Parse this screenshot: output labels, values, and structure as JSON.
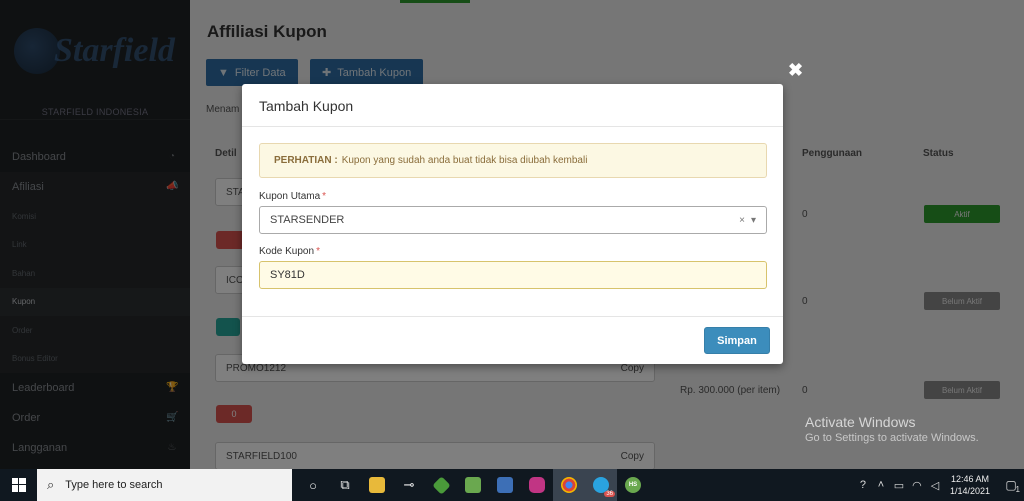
{
  "sidebar": {
    "brand_name": "Starfield",
    "org_name": "STARFIELD INDONESIA",
    "items": [
      {
        "label": "Dashboard",
        "icon": "dashboard-icon",
        "glyph": "◔"
      },
      {
        "label": "Afiliasi",
        "icon": "bullhorn-icon",
        "glyph": "📣"
      },
      {
        "label": "Komisi"
      },
      {
        "label": "Link"
      },
      {
        "label": "Bahan"
      },
      {
        "label": "Kupon"
      },
      {
        "label": "Order"
      },
      {
        "label": "Bonus Editor"
      },
      {
        "label": "Leaderboard",
        "icon": "trophy-icon",
        "glyph": "🏆"
      },
      {
        "label": "Order",
        "icon": "cart-icon",
        "glyph": "🛒"
      },
      {
        "label": "Langganan",
        "icon": "fire-icon",
        "glyph": "♨"
      }
    ]
  },
  "page": {
    "title": "Affiliasi Kupon",
    "filter_button": "Filter Data",
    "add_button": "Tambah Kupon",
    "showing_text": "Menam",
    "col_detail": "Detil",
    "col_usage": "Penggunaan",
    "col_status": "Status",
    "row1_code": "STA",
    "row2_code": "ICO",
    "row3_code": "PROMO1212",
    "row4_code": "STARFIELD100",
    "copy_label": "Copy",
    "price_text": "Rp. 300.000 (per item)",
    "usage_1": "0",
    "usage_2": "0",
    "usage_3": "0",
    "status_1": "Aktif",
    "status_2": "Belum Aktif",
    "status_3": "Belum Aktif",
    "badge_count": "0"
  },
  "modal": {
    "title": "Tambah Kupon",
    "alert_strong": "PERHATIAN :",
    "alert_text": "Kupon yang sudah anda buat tidak bisa diubah kembali",
    "kupon_utama_label": "Kupon Utama",
    "required_mark": "*",
    "kupon_utama_value": "STARSENDER",
    "kode_kupon_label": "Kode Kupon",
    "kode_kupon_value": "SY81D",
    "save_label": "Simpan",
    "close_glyph": "✖"
  },
  "watermark": {
    "title": "Activate Windows",
    "subtitle": "Go to Settings to activate Windows."
  },
  "taskbar": {
    "search_placeholder": "Type here to search",
    "time": "12:46 AM",
    "date": "1/14/2021",
    "telegram_badge": "36",
    "notification_count": "1",
    "hs_label": "HS"
  },
  "colors": {
    "primary": "#3c8dbc",
    "alert_bg": "#fcf8e3",
    "danger": "#d9534f",
    "success": "#2c9a2c"
  }
}
